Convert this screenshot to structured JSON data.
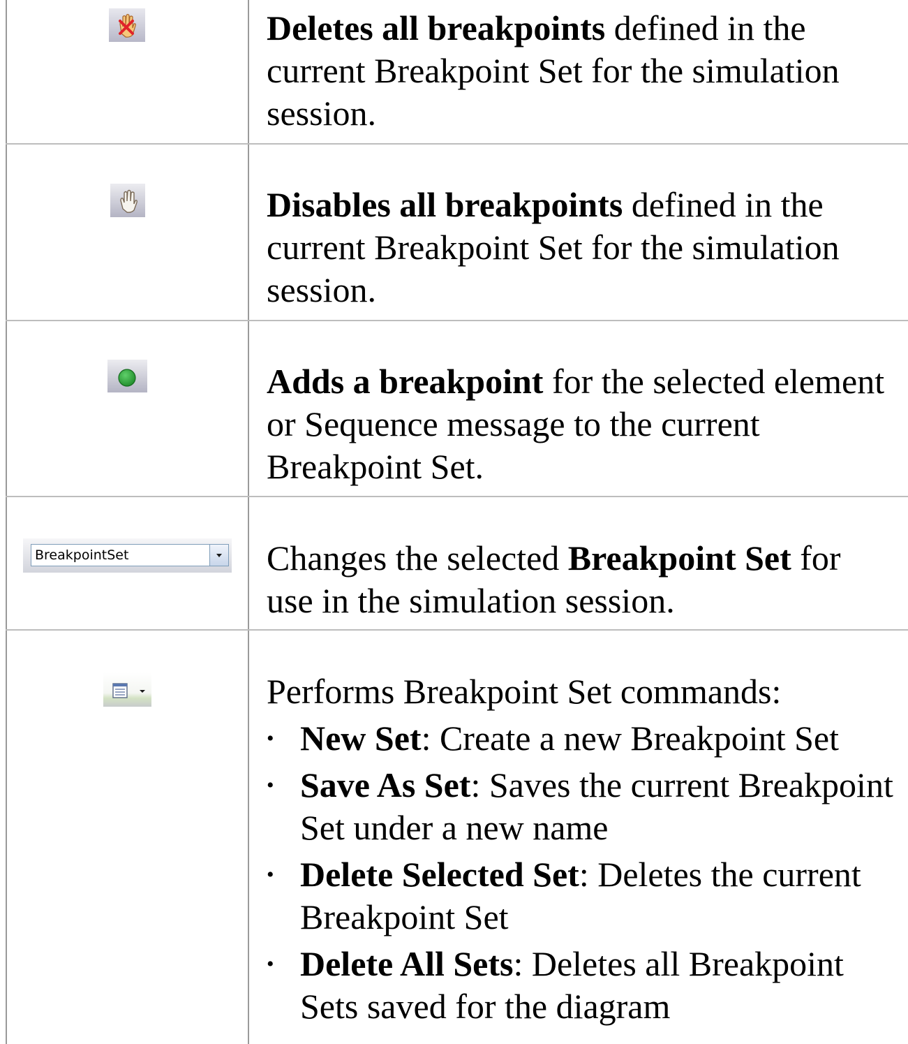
{
  "rows": [
    {
      "icon": "delete-breakpoints-icon",
      "bold": "Deletes all breakpoints",
      "rest": " defined in the current Breakpoint Set for the simulation session."
    },
    {
      "icon": "disable-breakpoints-icon",
      "bold": "Disables all breakpoints",
      "rest": " defined in the current Breakpoint Set for the simulation session."
    },
    {
      "icon": "add-breakpoint-icon",
      "bold": "Adds a breakpoint",
      "rest": " for the selected element or Sequence message to the current Breakpoint Set."
    },
    {
      "icon": "breakpoint-set-dropdown",
      "dropdown_value": "BreakpointSet",
      "pre": "Changes the selected ",
      "bold": "Breakpoint Set",
      "rest": " for use in the simulation session."
    },
    {
      "icon": "breakpoint-set-commands-icon",
      "intro": "Performs Breakpoint Set commands:",
      "commands": [
        {
          "bold": "New Set",
          "rest": ": Create a new Breakpoint Set"
        },
        {
          "bold": "Save As Set",
          "rest": ": Saves the current Breakpoint Set under a new name"
        },
        {
          "bold": "Delete Selected Set",
          "rest": ": Deletes the current Breakpoint Set"
        },
        {
          "bold": "Delete All Sets",
          "rest": ": Deletes all Breakpoint Sets saved for the diagram"
        }
      ],
      "bullet": "•"
    }
  ],
  "colors": {
    "border": "#9a9a9a",
    "green": "#1f9a2e"
  }
}
